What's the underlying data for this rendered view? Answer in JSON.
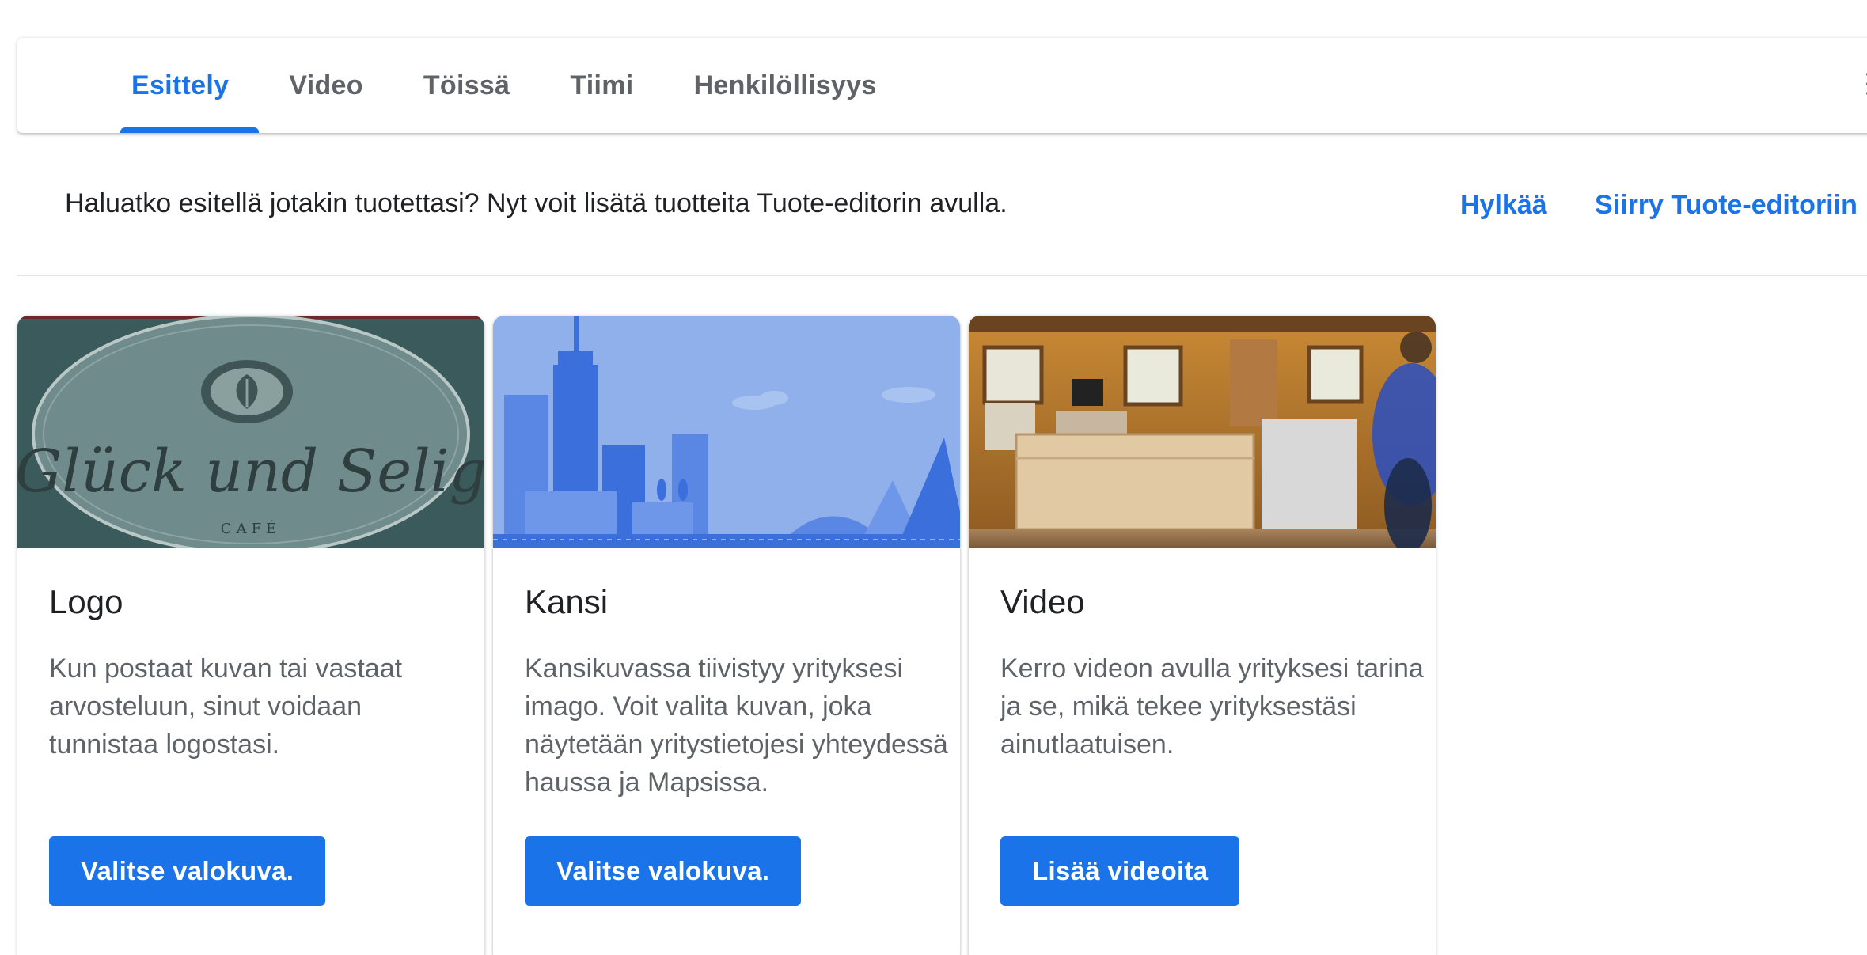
{
  "tabs": [
    {
      "label": "Esittely",
      "active": true
    },
    {
      "label": "Video",
      "active": false
    },
    {
      "label": "Töissä",
      "active": false
    },
    {
      "label": "Tiimi",
      "active": false
    },
    {
      "label": "Henkilöllisyys",
      "active": false
    }
  ],
  "banner": {
    "text": "Haluatko esitellä jotakin tuotettasi? Nyt voit lisätä tuotteita Tuote-editorin avulla.",
    "dismiss_label": "Hylkää",
    "go_label": "Siirry Tuote-editoriin"
  },
  "cards": [
    {
      "title": "Logo",
      "desc": "Kun postaat kuvan tai vastaat arvosteluun, sinut voidaan tunnistaa logostasi.",
      "button": "Valitse valokuva.",
      "logo_text": "Glück und Selig",
      "logo_sub": "CAFÉ"
    },
    {
      "title": "Kansi",
      "desc": "Kansikuvassa tiivistyy yrityksesi imago. Voit valita kuvan, joka näytetään yritystietojesi yhteydessä haussa ja Mapsissa.",
      "button": "Valitse valokuva."
    },
    {
      "title": "Video",
      "desc": "Kerro videon avulla yrityksesi tarina ja se, mikä tekee yrityksestäsi ainutlaatuisen.",
      "button": "Lisää videoita"
    }
  ],
  "colors": {
    "accent": "#1a73e8",
    "text_primary": "#202124",
    "text_secondary": "#5f6368"
  }
}
